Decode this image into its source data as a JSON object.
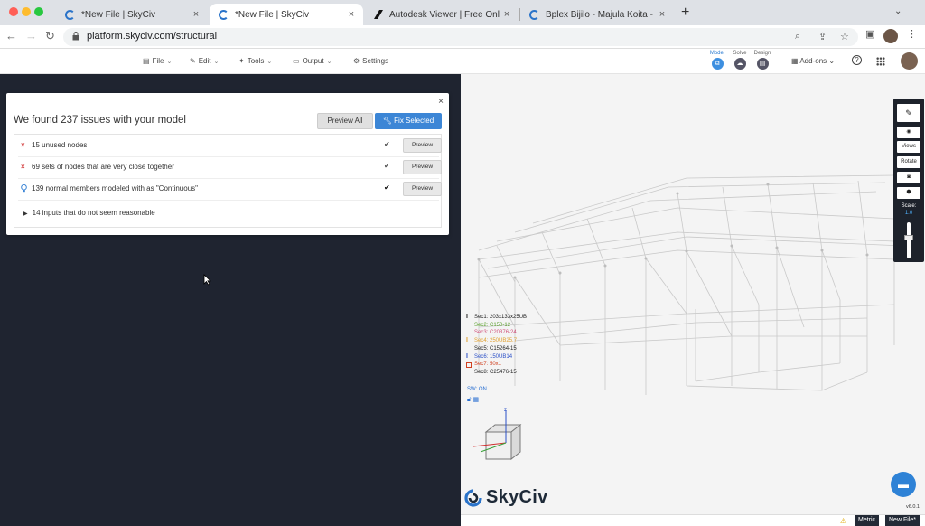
{
  "browser": {
    "tabs": [
      {
        "title": "*New File | SkyCiv",
        "close": "×"
      },
      {
        "title": "*New File | SkyCiv",
        "close": "×"
      },
      {
        "title": "Autodesk Viewer | Free Online",
        "close": "×"
      },
      {
        "title": "Bplex Bijilo - Majula Koita - bfo",
        "close": "×"
      }
    ],
    "new_tab": "+",
    "tab_menu": "⌄",
    "url": "platform.skyciv.com/structural"
  },
  "app_menu": {
    "file": "File",
    "edit": "Edit",
    "tools": "Tools",
    "output": "Output",
    "settings": "Settings",
    "modes": [
      {
        "label": "Model"
      },
      {
        "label": "Solve"
      },
      {
        "label": "Design"
      }
    ],
    "addons": "Add-ons",
    "help": "?"
  },
  "dialog": {
    "title": "We found 237 issues with your model",
    "preview_all": "Preview All",
    "fix_selected": "Fix Selected",
    "close": "×",
    "issues": [
      {
        "text": "15 unused nodes",
        "marker": "×",
        "preview": "Preview"
      },
      {
        "text": "69 sets of nodes that are very close together",
        "marker": "×",
        "preview": "Preview"
      },
      {
        "text": "139 normal members modeled with as \"Continuous\"",
        "marker": "💡",
        "preview": "Preview"
      }
    ],
    "collapsed": "14 inputs that do not seem reasonable"
  },
  "side_toolbar": {
    "views": "Views",
    "rotate": "Rotate",
    "scale_label": "Scale:",
    "scale_value": "1.0"
  },
  "sections": [
    {
      "label": "Sec1: 203x133x25UB",
      "color": "#222222"
    },
    {
      "label": "Sec2: C150-12",
      "color": "#5aa02c"
    },
    {
      "label": "Sec3: C20376-24",
      "color": "#d0507a"
    },
    {
      "label": "Sec4: 250UB25.7",
      "color": "#e0a030"
    },
    {
      "label": "Sec5: C15264-15",
      "color": "#222222"
    },
    {
      "label": "Sec6: 150UB14",
      "color": "#2a4fc7"
    },
    {
      "label": "Sec7: 50x1",
      "color": "#d04020"
    },
    {
      "label": "Sec8: C25476-15",
      "color": "#222222"
    }
  ],
  "sw_status": "SW: ON",
  "brand": "SkyCiv",
  "version": "v6.0.1",
  "status": {
    "units": "Metric",
    "file": "New File*"
  },
  "colors": {
    "accent": "#3c86d6",
    "dark_bg": "#1f2430"
  }
}
